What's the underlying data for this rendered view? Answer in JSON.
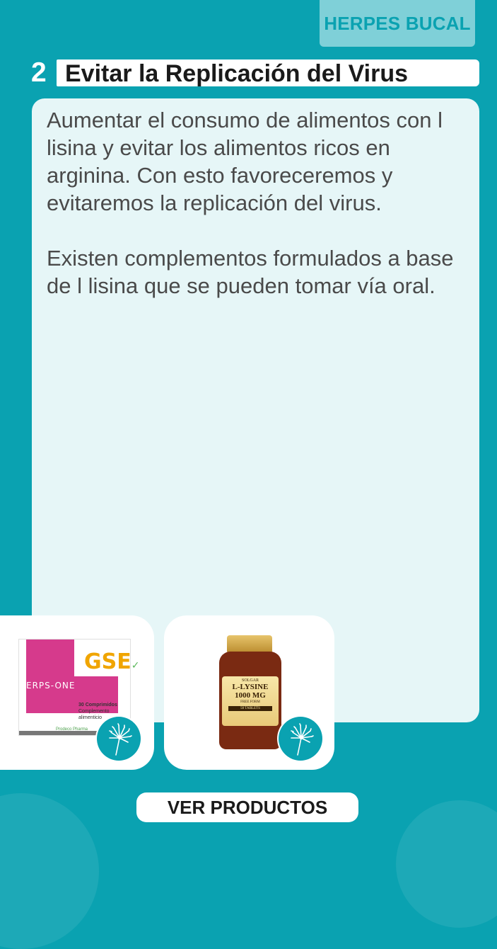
{
  "header": {
    "category_tag": "HERPES BUCAL"
  },
  "step": {
    "number": "2",
    "title": "Evitar la Replicación del Virus"
  },
  "content": {
    "paragraphs": [
      "Aumentar el consumo de alimentos con l lisina y evitar los alimentos ricos en arginina. Con esto favoreceremos y evitaremos la replicación del virus.",
      "Existen complementos formulados a base de l lisina que se pueden tomar vía oral."
    ]
  },
  "products": [
    {
      "brand_mark": "GSE",
      "name": "ERPS-ONE",
      "quantity": "30 Comprimidos",
      "subtitle": "Complemento alimenticio",
      "maker": "Prodeco Pharma",
      "badge_icon": "dandelion-icon"
    },
    {
      "maker_logo": "SOLGAR",
      "name": "L-LYSINE",
      "dose": "1000 MG",
      "form": "FREE FORM",
      "count": "50 TABLETS",
      "badge_icon": "dandelion-icon"
    }
  ],
  "cta": {
    "label": "VER PRODUCTOS"
  },
  "colors": {
    "background": "#0aa2b1",
    "card": "#e6f6f7",
    "tag": "#7fd0d8",
    "text": "#4a4a4a"
  }
}
